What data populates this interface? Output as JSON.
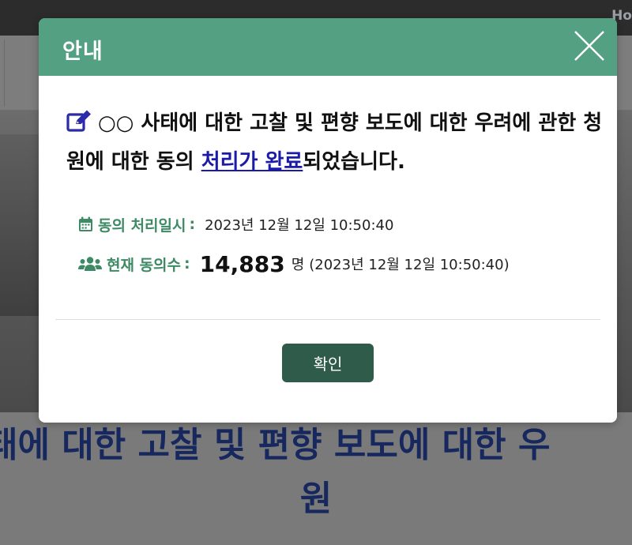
{
  "background": {
    "header_link": "Ho",
    "title_line1": "태에 대한 고찰 및 편향 보도에 대한 우",
    "title_line2": "원"
  },
  "modal": {
    "title": "안내",
    "message_part1": "○○ 사태에 대한 고찰 및 편향 보도에 대한 우려에 관한 청원에 대한 동의 ",
    "message_link": "처리가 완료",
    "message_part2": "되었습니다.",
    "processed_label": "동의 처리일시",
    "processed_value": "2023년 12월 12일 10:50:40",
    "count_label": "현재 동의수",
    "count_value": "14,883",
    "count_unit": "명",
    "count_timestamp": "(2023년 12월 12일 10:50:40)",
    "confirm_label": "확인"
  },
  "colors": {
    "header_green": "#54a082",
    "label_green": "#3d8a64",
    "button_dark_green": "#2e5b4a",
    "link_blue": "#1b1ba8",
    "title_navy": "#17285e"
  },
  "icons": {
    "close": "close-icon",
    "edit": "edit-icon",
    "calendar": "calendar-icon",
    "users": "users-icon"
  }
}
